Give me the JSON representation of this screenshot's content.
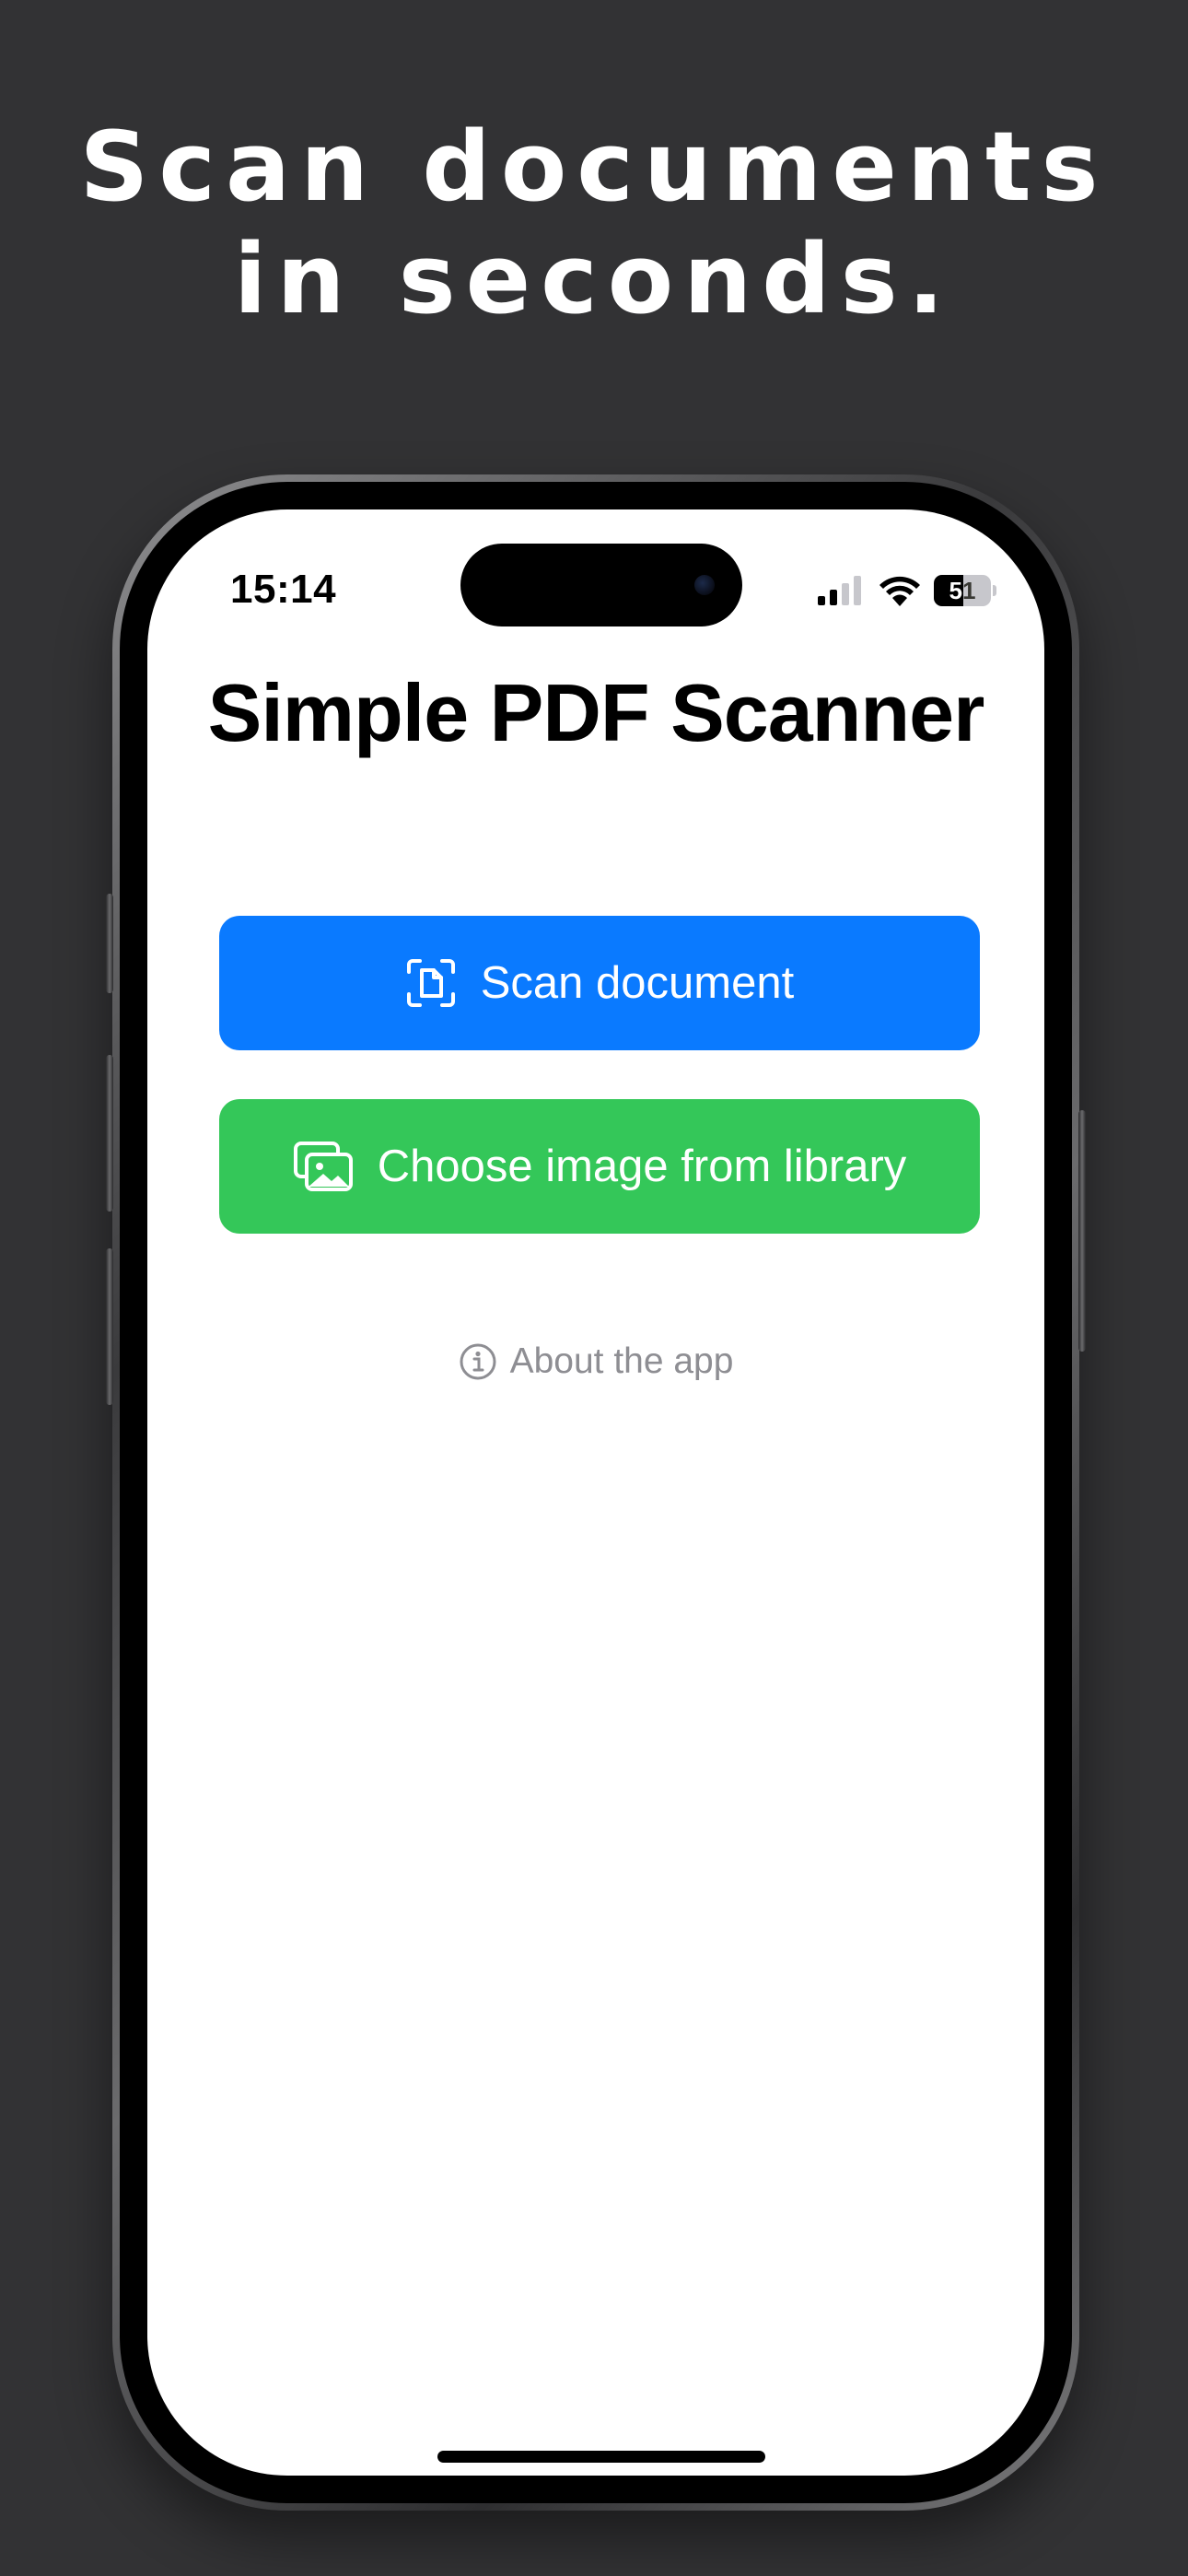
{
  "headline": {
    "line1": "Scan documents",
    "line2": "in seconds."
  },
  "status_bar": {
    "time": "15:14",
    "battery": "51",
    "battery_level_percent": 51,
    "icons": [
      "cellular-signal-icon",
      "wifi-icon",
      "battery-icon"
    ]
  },
  "app": {
    "title": "Simple PDF Scanner",
    "scan_button": {
      "label": "Scan document",
      "icon": "doc-viewfinder-icon",
      "color": "#0A7AFF"
    },
    "library_button": {
      "label": "Choose image from library",
      "icon": "photo-stack-icon",
      "color": "#34C759"
    },
    "about_link": {
      "label": "About the app",
      "icon": "info-circle-icon",
      "color": "#8E8E93"
    }
  },
  "colors": {
    "background": "#323234",
    "screen": "#FFFFFF"
  }
}
